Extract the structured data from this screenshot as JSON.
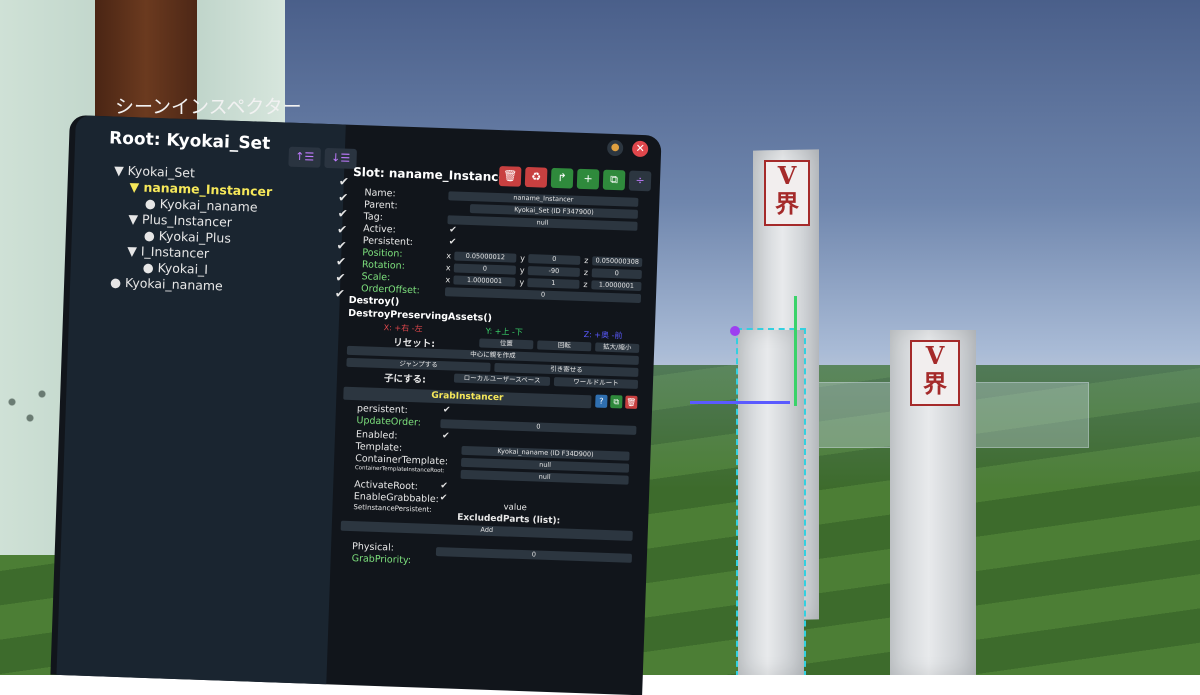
{
  "panel": {
    "title": "シーンインスペクター",
    "root_label": "Root: Kyokai_Set",
    "header_btn_up": "↑☰",
    "header_btn_down": "↓☰"
  },
  "tree": [
    {
      "label": "▼ Kyokai_Set",
      "selected": false
    },
    {
      "label": "▼ naname_Instancer",
      "selected": true
    },
    {
      "label": "● Kyokai_naname",
      "selected": false
    },
    {
      "label": "▼ Plus_Instancer",
      "selected": false
    },
    {
      "label": "● Kyokai_Plus",
      "selected": false
    },
    {
      "label": "▼ I_Instancer",
      "selected": false
    },
    {
      "label": "● Kyokai_I",
      "selected": false
    },
    {
      "label": "● Kyokai_naname",
      "selected": false
    }
  ],
  "tree_checks": "✔",
  "slot": {
    "title": "Slot: naname_Instancer",
    "fields": {
      "name_label": "Name:",
      "name_value": "naname_Instancer",
      "parent_label": "Parent:",
      "parent_value": "Kyokai_Set (ID F347900)",
      "tag_label": "Tag:",
      "tag_value": "null",
      "active_label": "Active:",
      "persistent_label": "Persistent:",
      "position_label": "Position:",
      "position": [
        "0.05000012",
        "0",
        "0.050000308"
      ],
      "rotation_label": "Rotation:",
      "rotation": [
        "0",
        "-90",
        "0"
      ],
      "scale_label": "Scale:",
      "scale": [
        "1.0000001",
        "1",
        "1.0000001"
      ],
      "orderoffset_label": "OrderOffset:",
      "orderoffset_value": "0",
      "check": "✔"
    },
    "axes": [
      "x",
      "y",
      "z"
    ],
    "commands": {
      "destroy": "Destroy()",
      "destroy_preserving": "DestroyPreservingAssets()",
      "x_hint": "X: +右 -左",
      "y_hint": "Y: +上 -下",
      "z_hint": "Z: +奥 -前",
      "reset_label": "リセット:",
      "reset_position": "位置",
      "reset_rotation": "回転",
      "reset_scale": "拡大/縮小",
      "create_parent_center": "中心に親を作成",
      "jump": "ジャンプする",
      "pull": "引き寄せる",
      "make_child_label": "子にする:",
      "local_user_space": "ローカルユーザースペース",
      "world_root": "ワールドルート"
    }
  },
  "component": {
    "name": "GrabInstancer",
    "fields": {
      "persistent": "persistent:",
      "update_order": "UpdateOrder:",
      "update_order_value": "0",
      "enabled": "Enabled:",
      "template": "Template:",
      "template_value": "Kyokai_naname (ID F34D900)",
      "container_template": "ContainerTemplate:",
      "container_template_value": "null",
      "container_template_instance_root": "ContainerTemplateInstanceRoot:",
      "container_template_instance_root_value": "null",
      "activate_root": "ActivateRoot:",
      "enable_grabbable": "EnableGrabbable:",
      "set_instance_persistent": "SetInstancePersistent:",
      "value_label": "value",
      "excluded_parts": "ExcludedParts (list):",
      "add": "Add",
      "physical": "Physical:",
      "grab_priority": "GrabPriority:",
      "grab_priority_value": "0"
    }
  },
  "signs": {
    "left": "V\n界",
    "right": "V\n界"
  },
  "colors": {
    "accent_yellow": "#f6e85a",
    "close_red": "#e0474c",
    "axis_x": "#e0474c",
    "axis_y": "#3ad36a",
    "axis_z": "#5a5aff"
  }
}
